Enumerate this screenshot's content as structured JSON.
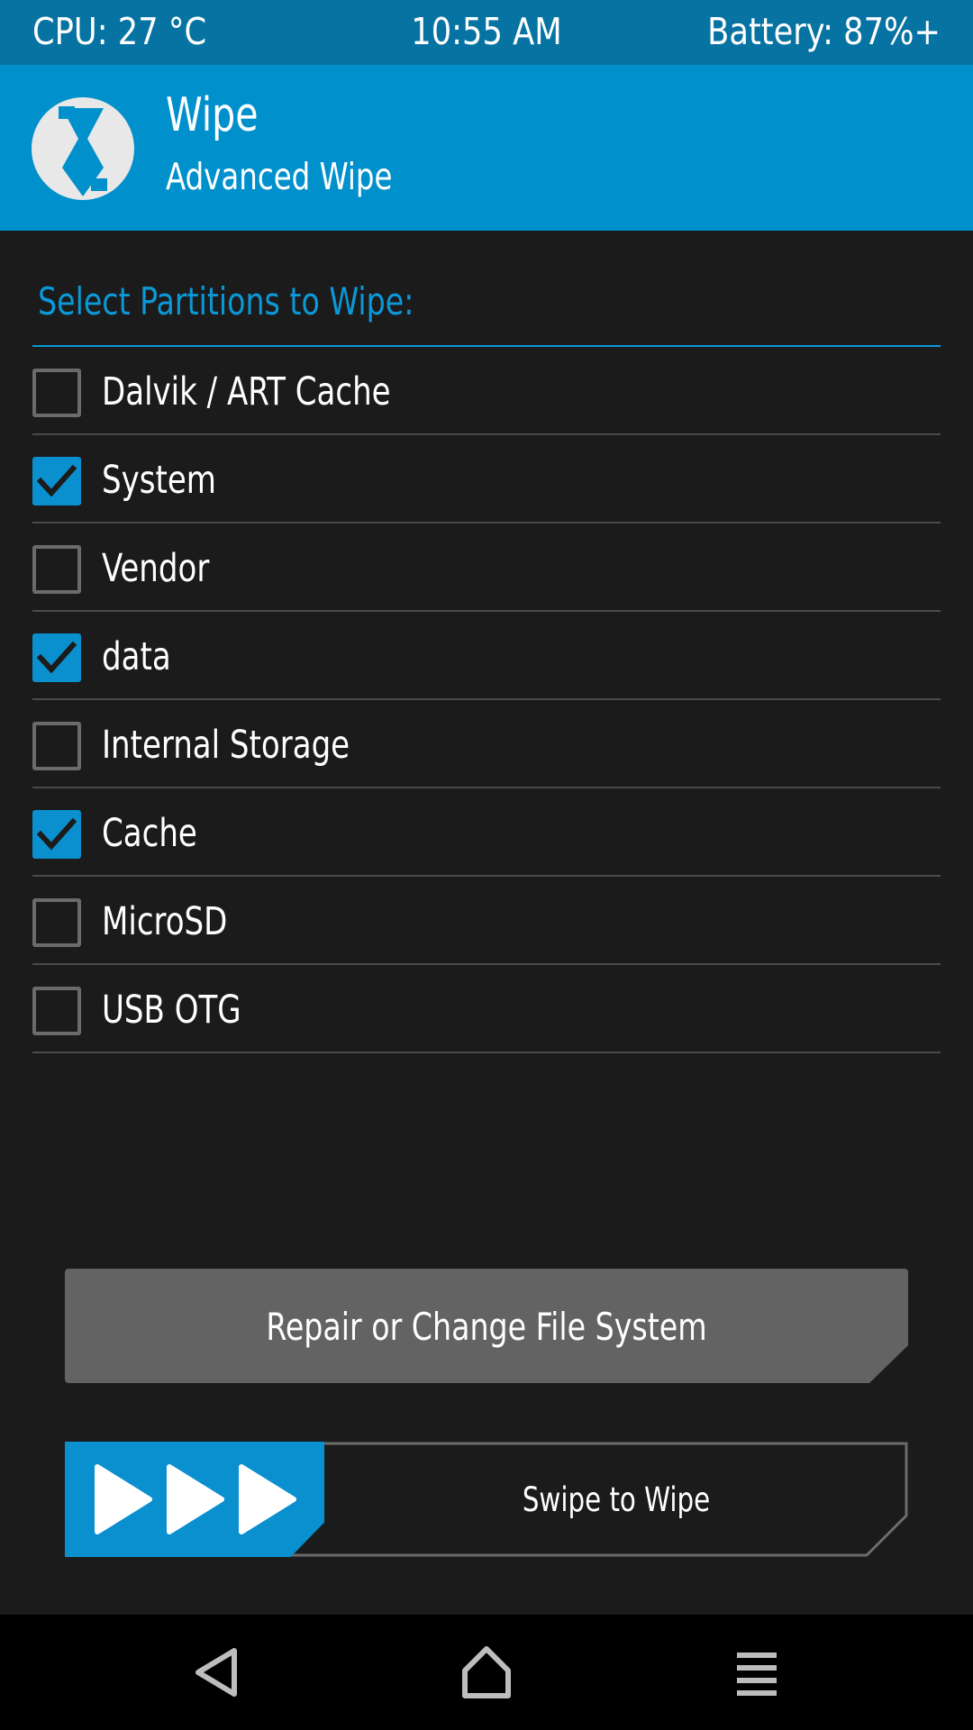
{
  "status_bar": {
    "cpu": "CPU: 27 °C",
    "time": "10:55 AM",
    "battery": "Battery: 87%+"
  },
  "header": {
    "title": "Wipe",
    "subtitle": "Advanced Wipe",
    "logo_icon": "twrp-logo-icon"
  },
  "partitions": {
    "title": "Select Partitions to Wipe:",
    "items": [
      {
        "label": "Dalvik / ART Cache",
        "checked": false
      },
      {
        "label": "System",
        "checked": true
      },
      {
        "label": "Vendor",
        "checked": false
      },
      {
        "label": "data",
        "checked": true
      },
      {
        "label": "Internal Storage",
        "checked": false
      },
      {
        "label": "Cache",
        "checked": true
      },
      {
        "label": "MicroSD",
        "checked": false
      },
      {
        "label": "USB OTG",
        "checked": false
      }
    ]
  },
  "actions": {
    "repair_label": "Repair or Change File System",
    "swipe_label": "Swipe to Wipe",
    "swipe_icon": "triple-arrow-icon"
  },
  "navbar": {
    "back_icon": "back-triangle-icon",
    "home_icon": "home-icon",
    "menu_icon": "menu-icon"
  },
  "colors": {
    "status_bar": "#0673a2",
    "header": "#0090cc",
    "accent": "#0a98d6",
    "background": "#1b1b1b",
    "button_gray": "#636363",
    "navbar": "#000000"
  }
}
